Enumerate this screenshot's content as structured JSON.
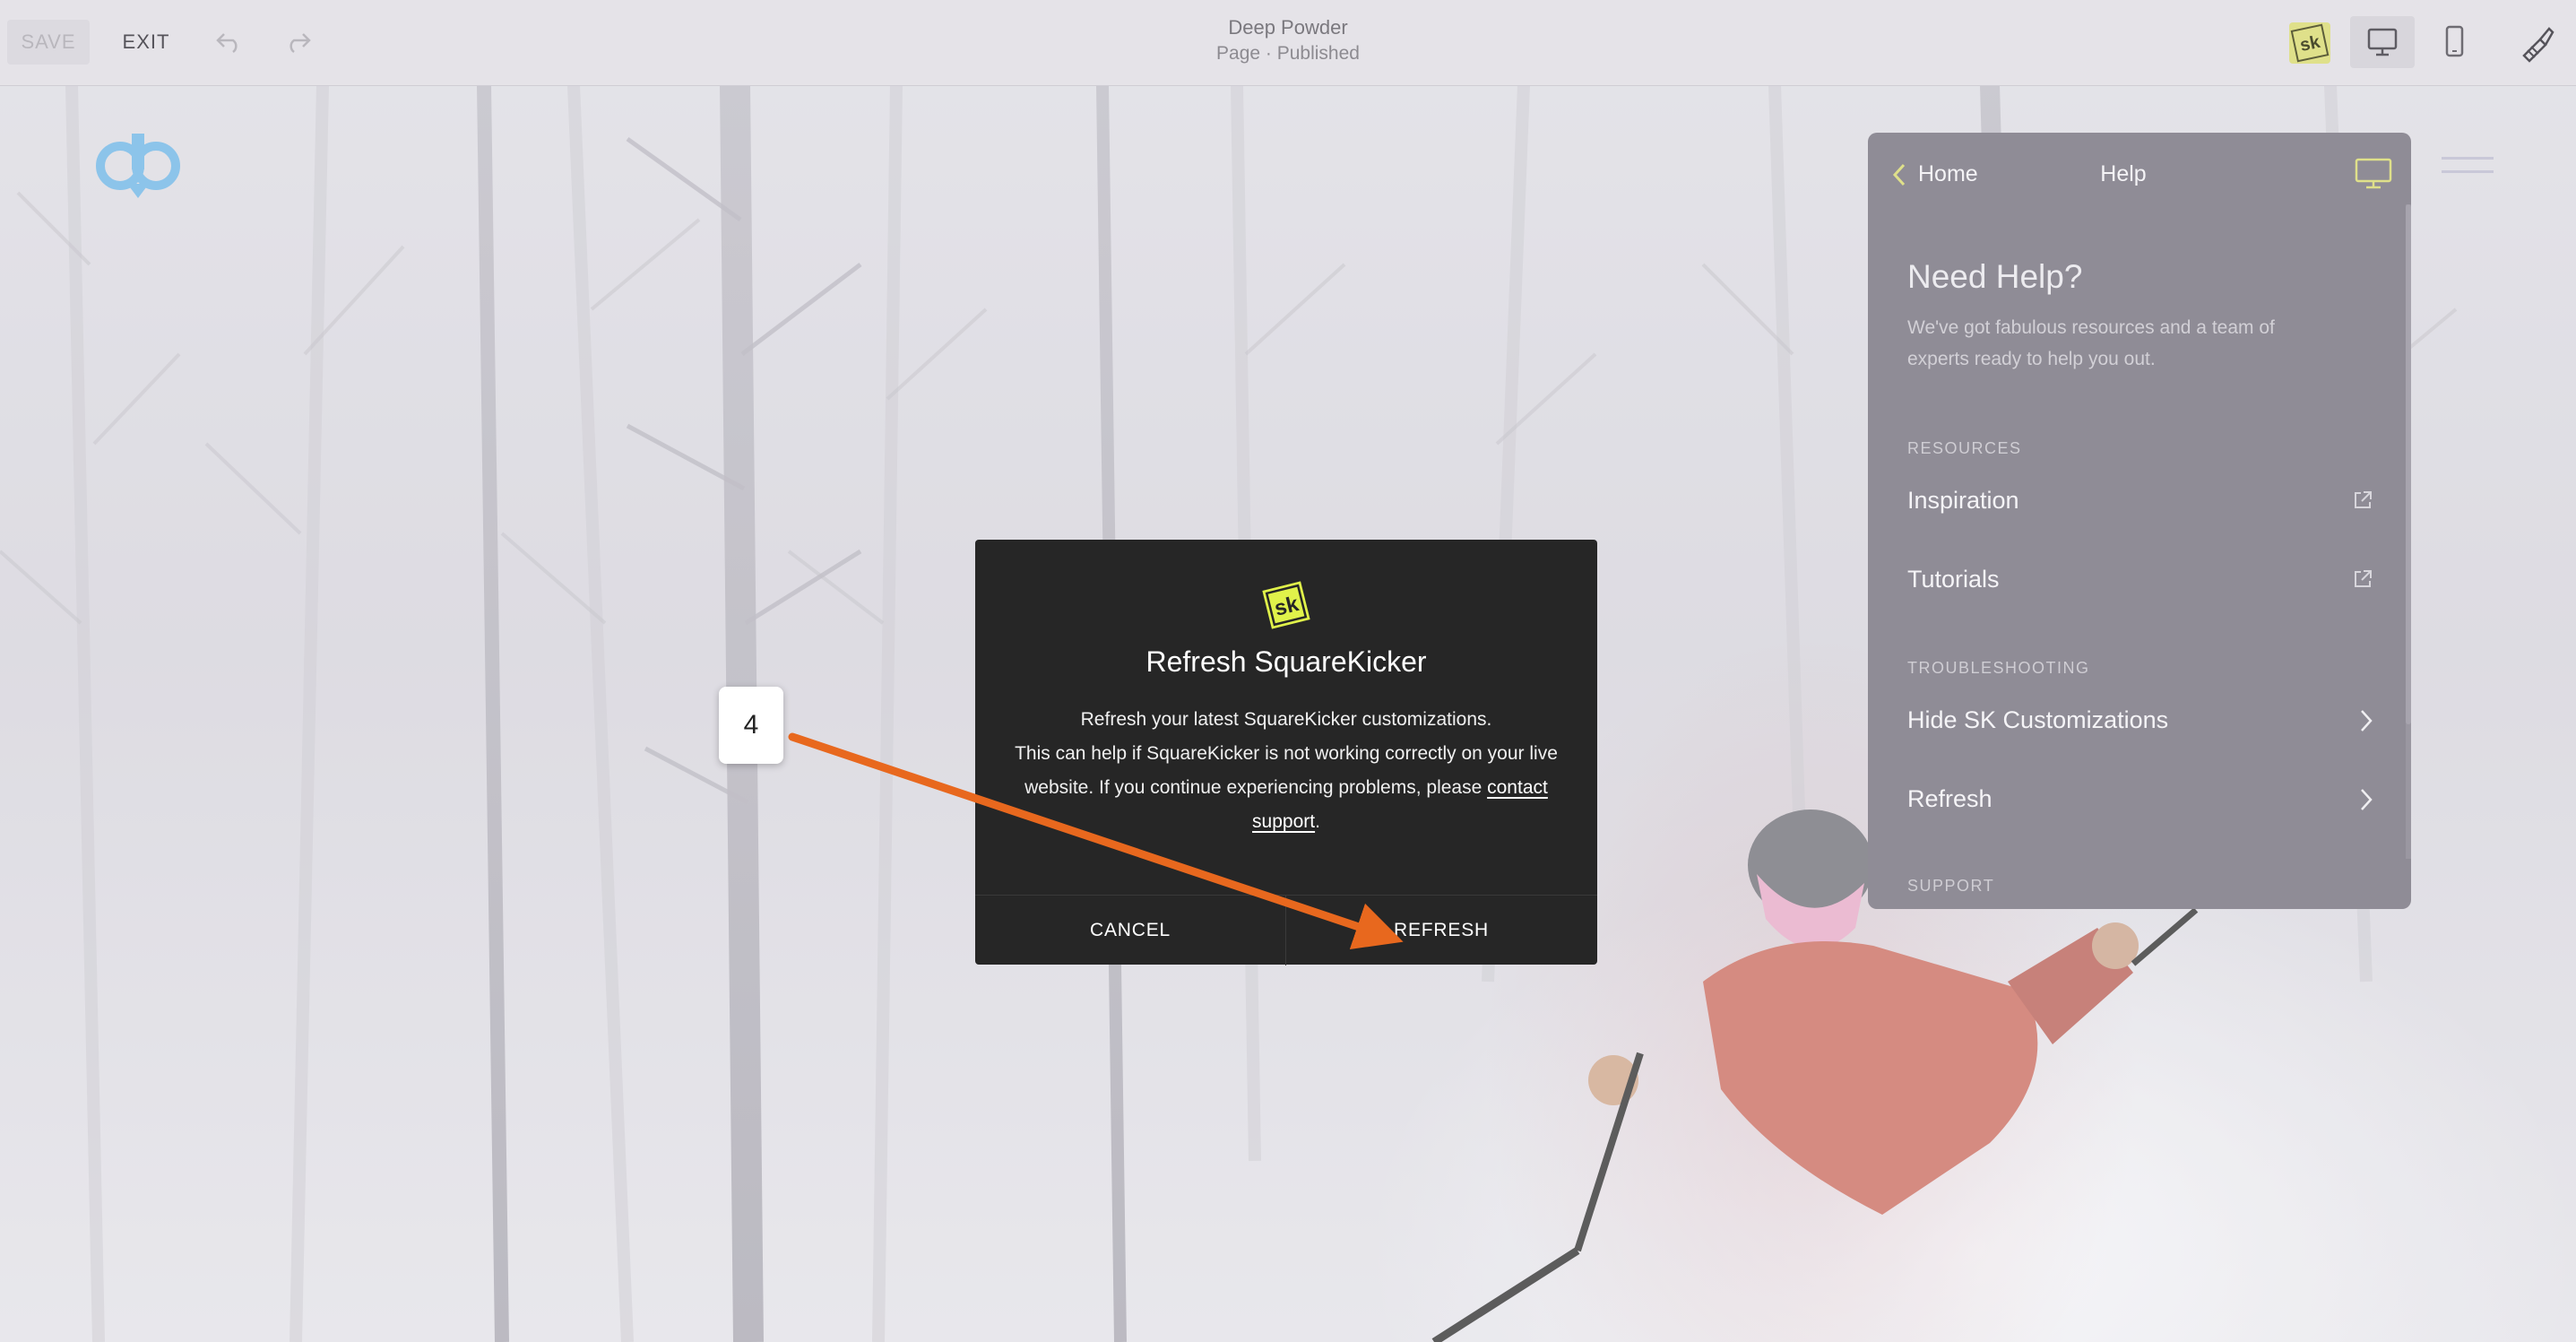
{
  "topbar": {
    "save_label": "SAVE",
    "exit_label": "EXIT",
    "page_title": "Deep Powder",
    "page_status": "Page · Published",
    "sk_badge": "sk"
  },
  "help_panel": {
    "back_label": "Home",
    "title": "Help",
    "heading": "Need Help?",
    "description": "We've got fabulous resources and a team of experts ready to help you out.",
    "sections": [
      {
        "label": "RESOURCES",
        "items": [
          "Inspiration",
          "Tutorials"
        ]
      },
      {
        "label": "TROUBLESHOOTING",
        "items": [
          "Hide SK Customizations",
          "Refresh"
        ]
      },
      {
        "label": "SUPPORT",
        "items": []
      }
    ]
  },
  "modal": {
    "logo_text": "sk",
    "title": "Refresh SquareKicker",
    "body_line1": "Refresh your latest SquareKicker customizations.",
    "body_line2": "This can help if SquareKicker is not working correctly on your live website. If you continue experiencing problems, please",
    "link_text": "contact support",
    "body_end": ".",
    "cancel_label": "CANCEL",
    "refresh_label": "REFRESH"
  },
  "annotation": {
    "step_number": "4",
    "arrow_color": "#e8681e"
  },
  "colors": {
    "sk_accent": "#e0f24a",
    "modal_bg": "#262626",
    "panel_bg": "#8f8c96",
    "logo_blue": "#8cc4ea"
  }
}
